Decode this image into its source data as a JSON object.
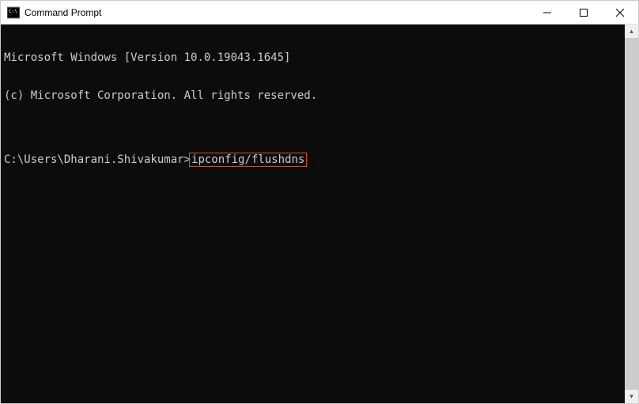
{
  "titlebar": {
    "title": "Command Prompt",
    "minimize": "—",
    "maximize": "☐",
    "close": "✕"
  },
  "terminal": {
    "line1": "Microsoft Windows [Version 10.0.19043.1645]",
    "line2": "(c) Microsoft Corporation. All rights reserved.",
    "blank": "",
    "prompt": "C:\\Users\\Dharani.Shivakumar>",
    "command": "ipconfig/flushdns"
  },
  "scrollbar": {
    "up": "▲",
    "down": "▼"
  }
}
